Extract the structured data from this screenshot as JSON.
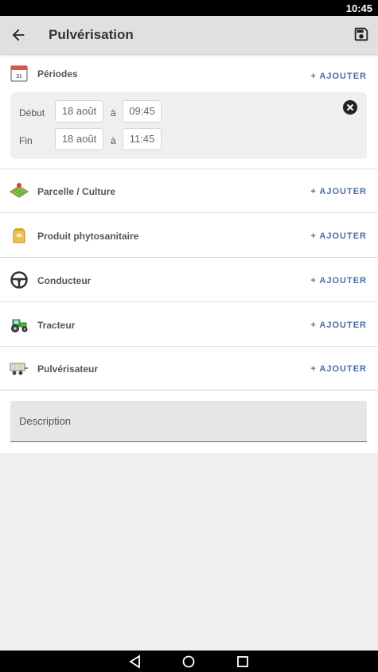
{
  "status": {
    "time": "10:45"
  },
  "appbar": {
    "title": "Pulvérisation",
    "back_icon": "arrow-back-icon",
    "save_icon": "save-icon"
  },
  "sections": {
    "periodes": {
      "label": "Périodes",
      "add": "+ AJOUTER",
      "icon": "calendar-icon"
    },
    "parcelle": {
      "label": "Parcelle / Culture",
      "add": "+ AJOUTER",
      "icon": "field-icon"
    },
    "produit": {
      "label": "Produit phytosanitaire",
      "add": "+ AJOUTER",
      "icon": "product-bag-icon"
    },
    "conducteur": {
      "label": "Conducteur",
      "add": "+ AJOUTER",
      "icon": "steering-wheel-icon"
    },
    "tracteur": {
      "label": "Tracteur",
      "add": "+ AJOUTER",
      "icon": "tractor-icon"
    },
    "pulverisateur": {
      "label": "Pulvérisateur",
      "add": "+ AJOUTER",
      "icon": "sprayer-icon"
    }
  },
  "period": {
    "start_label": "Début",
    "start_date": "18 août",
    "start_sep": "à",
    "start_time": "09:45",
    "end_label": "Fin",
    "end_date": "18 août",
    "end_sep": "à",
    "end_time": "11:45",
    "calendar_day": "31"
  },
  "description": {
    "placeholder": "Description"
  },
  "colors": {
    "accent": "#4a6fa5",
    "appbar": "#e0e0e0",
    "background": "#efefef"
  }
}
